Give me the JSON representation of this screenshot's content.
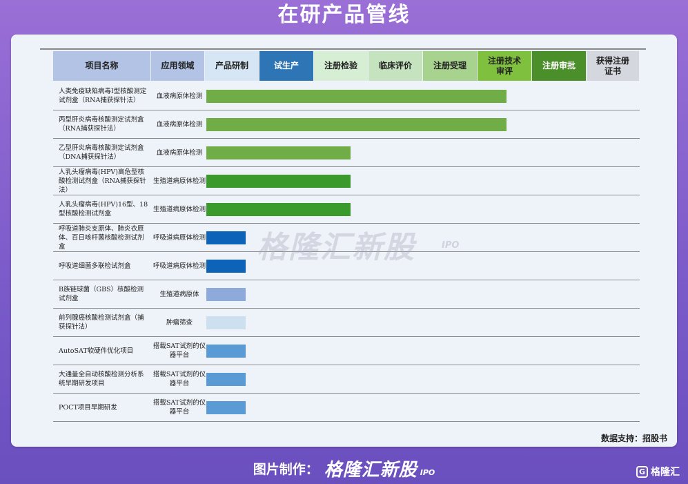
{
  "title": "在研产品管线",
  "source": "数据支持：招股书",
  "watermark": {
    "brand": "格隆汇新股",
    "sub": "IPO"
  },
  "footer": {
    "label": "图片制作：",
    "brand": "格隆汇新股",
    "ipo": "IPO",
    "corner_text": "格隆汇",
    "corner_icon": "G"
  },
  "columns": [
    {
      "label": "项目名称",
      "bg": "#b2c3e6",
      "color": "#222222"
    },
    {
      "label": "应用领域",
      "bg": "#b2c3e6",
      "color": "#222222"
    },
    {
      "label": "产品研制",
      "bg": "#d6e6f4",
      "color": "#222222"
    },
    {
      "label": "试生产",
      "bg": "#2e75b6",
      "color": "#ffffff"
    },
    {
      "label": "注册检验",
      "bg": "#d6eed4",
      "color": "#222222"
    },
    {
      "label": "临床评价",
      "bg": "#c5e3bf",
      "color": "#222222"
    },
    {
      "label": "注册受理",
      "bg": "#a8d38f",
      "color": "#222222"
    },
    {
      "label": "注册技术审评",
      "bg": "#7fc03e",
      "color": "#222222"
    },
    {
      "label": "注册审批",
      "bg": "#4b8f2a",
      "color": "#ffffff"
    },
    {
      "label": "获得注册证书",
      "bg": "#d4d8de",
      "color": "#222222"
    }
  ],
  "chart_data": {
    "type": "bar",
    "stages": [
      "产品研制",
      "试生产",
      "注册检验",
      "临床评价",
      "注册受理",
      "注册技术审评",
      "注册审批",
      "获得注册证书"
    ],
    "rows": [
      {
        "name": "人类免疫缺陷病毒Ⅰ型核酸测定试剂盒（RNA捕获探针法）",
        "field": "血液病原体检测",
        "progress": 5.5,
        "color": "#70ad47"
      },
      {
        "name": "丙型肝炎病毒核酸测定试剂盒（RNA捕获探针法）",
        "field": "血液病原体检测",
        "progress": 5.5,
        "color": "#70ad47"
      },
      {
        "name": "乙型肝炎病毒核酸测定试剂盒（DNA捕获探针法）",
        "field": "血液病原体检测",
        "progress": 2.65,
        "color": "#70ad47"
      },
      {
        "name": "人乳头瘤病毒(HPV)高危型核酸检测试剂盒（RNA捕获探针法）",
        "field": "生殖道病原体检测",
        "progress": 2.65,
        "color": "#3a9a2c"
      },
      {
        "name": "人乳头瘤病毒(HPV)16型、18型核酸检测试剂盒",
        "field": "生殖道病原体检测",
        "progress": 2.65,
        "color": "#3a9a2c"
      },
      {
        "name": "呼吸道肺炎支原体、肺炎衣原体、百日咳杆菌核酸检测试剂盒",
        "field": "呼吸道病原体检测",
        "progress": 0.72,
        "color": "#0d63b8"
      },
      {
        "name": "呼吸道细菌多联检试剂盒",
        "field": "呼吸道病原体检测",
        "progress": 0.72,
        "color": "#0d63b8"
      },
      {
        "name": "B族链球菌（GBS）核酸检测试剂盒",
        "field": "生殖道病原体",
        "progress": 0.72,
        "color": "#8eaadb"
      },
      {
        "name": "前列腺癌核酸检测试剂盒（捕获探针法）",
        "field": "肿瘤筛查",
        "progress": 0.72,
        "color": "#cde0f0"
      },
      {
        "name": "AutoSAT软硬件优化项目",
        "field": "搭载SAT试剂的仪器平台",
        "progress": 0.72,
        "color": "#5b9bd5"
      },
      {
        "name": "大通量全自动核酸检测分析系统早期研发项目",
        "field": "搭载SAT试剂的仪器平台",
        "progress": 0.72,
        "color": "#5b9bd5"
      },
      {
        "name": "POCT项目早期研发",
        "field": "搭载SAT试剂的仪器平台",
        "progress": 0.72,
        "color": "#5b9bd5"
      }
    ]
  }
}
